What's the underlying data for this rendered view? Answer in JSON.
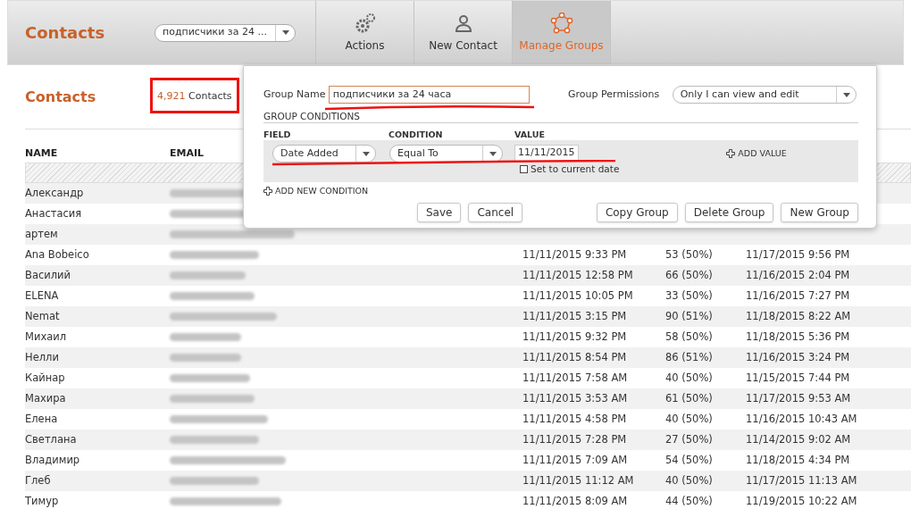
{
  "header": {
    "title": "Contacts",
    "group_select": "подписчики за 24 ...",
    "tabs": [
      {
        "label": "Actions",
        "kind": "gears",
        "selected": false
      },
      {
        "label": "New Contact",
        "kind": "person",
        "selected": false
      },
      {
        "label": "Manage Groups",
        "kind": "group",
        "selected": true
      }
    ]
  },
  "section": {
    "title": "Contacts",
    "count": "4,921",
    "count_label": "Contacts"
  },
  "table": {
    "columns": [
      "NAME",
      "EMAIL"
    ],
    "rows": [
      {
        "name": "Александр"
      },
      {
        "name": "Анастасия"
      },
      {
        "name": "артем"
      },
      {
        "name": "Ana Bobeico",
        "added": "11/11/2015 9:33 PM",
        "score": "53 (50%)",
        "last": "11/17/2015 9:56 PM"
      },
      {
        "name": "Василий",
        "added": "11/11/2015 12:58 PM",
        "score": "66 (50%)",
        "last": "11/16/2015 2:04 PM"
      },
      {
        "name": "ELENA",
        "added": "11/11/2015 10:05 PM",
        "score": "33 (50%)",
        "last": "11/16/2015 7:27 PM"
      },
      {
        "name": "Nemat",
        "added": "11/11/2015 3:15 PM",
        "score": "90 (51%)",
        "last": "11/18/2015 8:22 AM"
      },
      {
        "name": "Михаил",
        "added": "11/11/2015 9:32 PM",
        "score": "58 (50%)",
        "last": "11/18/2015 5:36 PM"
      },
      {
        "name": "Нелли",
        "added": "11/11/2015 8:54 PM",
        "score": "86 (51%)",
        "last": "11/16/2015 3:24 PM"
      },
      {
        "name": "Кайнар",
        "added": "11/11/2015 7:58 AM",
        "score": "40 (50%)",
        "last": "11/15/2015 7:44 PM"
      },
      {
        "name": "Махира",
        "added": "11/11/2015 3:53 AM",
        "score": "61 (50%)",
        "last": "11/17/2015 9:53 AM"
      },
      {
        "name": "Елена",
        "added": "11/11/2015 4:58 PM",
        "score": "40 (50%)",
        "last": "11/16/2015 10:43 AM"
      },
      {
        "name": "Светлана",
        "added": "11/11/2015 7:28 PM",
        "score": "27 (50%)",
        "last": "11/14/2015 9:02 AM"
      },
      {
        "name": "Владимир",
        "added": "11/11/2015 7:09 AM",
        "score": "54 (50%)",
        "last": "11/18/2015 4:34 PM"
      },
      {
        "name": "Глеб",
        "added": "11/11/2015 11:12 AM",
        "score": "40 (50%)",
        "last": "11/17/2015 11:13 AM"
      },
      {
        "name": "Тимур",
        "added": "11/11/2015 8:09 AM",
        "score": "44 (50%)",
        "last": "11/19/2015 10:22 AM"
      }
    ]
  },
  "group_panel": {
    "name_label": "Group Name",
    "name_value": "подписчики за 24 часа",
    "permissions_label": "Group Permissions",
    "permissions_value": "Only I can view and edit",
    "conditions_title": "GROUP CONDITIONS",
    "field_header": "FIELD",
    "condition_header": "CONDITION",
    "value_header": "VALUE",
    "field_value": "Date Added",
    "condition_value": "Equal To",
    "value": "11/11/2015",
    "current_date_label": "Set to current date",
    "current_date_checked": false,
    "add_value": "ADD VALUE",
    "add_condition": "ADD NEW CONDITION",
    "buttons": [
      "Save",
      "Cancel",
      "Copy Group",
      "Delete Group",
      "New Group"
    ]
  }
}
